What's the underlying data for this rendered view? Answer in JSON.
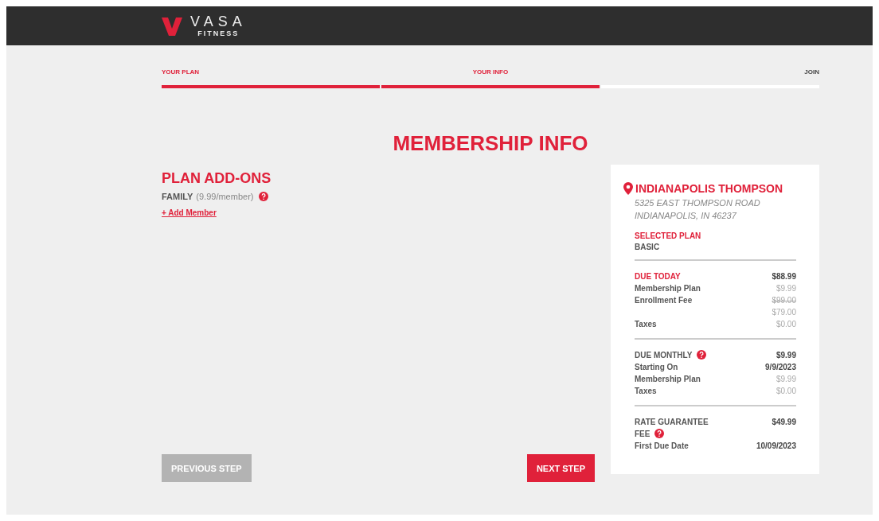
{
  "header": {
    "logo_word": "VASA",
    "logo_sub": "FITNESS"
  },
  "steps": [
    {
      "label": "YOUR PLAN",
      "complete": true
    },
    {
      "label": "YOUR INFO",
      "complete": true
    },
    {
      "label": "JOIN",
      "complete": false
    }
  ],
  "title": "MEMBERSHIP INFO",
  "addons": {
    "heading": "PLAN ADD-ONS",
    "name": "FAMILY",
    "price": "(9.99/member)",
    "help": true,
    "link": "+ Add Member"
  },
  "summary": {
    "location": "INDIANAPOLIS THOMPSON",
    "address_lines": [
      "5325 EAST THOMPSON ROAD",
      "INDIANAPOLIS, IN 46237"
    ],
    "plan_label": "SELECTED PLAN",
    "plan": "BASIC",
    "sections": [
      {
        "rows": [
          {
            "kind": "heading",
            "label": "DUE TODAY",
            "value": "$88.99",
            "help": false
          },
          {
            "kind": "detail",
            "label": "Membership Plan",
            "value": "$9.99",
            "help": false
          },
          {
            "kind": "detail",
            "label": "Enrollment Fee",
            "old_value": "$99.00",
            "value": "$79.00",
            "help": false
          },
          {
            "kind": "detail",
            "label": "Taxes",
            "value": "$0.00",
            "help": false
          }
        ]
      },
      {
        "rows": [
          {
            "kind": "total",
            "label": "DUE MONTHLY",
            "value": "$9.99",
            "help": true
          },
          {
            "kind": "info",
            "label": "Starting On",
            "value": "9/9/2023",
            "help": false
          },
          {
            "kind": "detail",
            "label": "Membership Plan",
            "value": "$9.99",
            "help": false
          },
          {
            "kind": "detail",
            "label": "Taxes",
            "value": "$0.00",
            "help": false
          }
        ]
      },
      {
        "rows": [
          {
            "kind": "total",
            "label": "RATE GUARANTEE",
            "label_wrap": "FEE",
            "value": "$49.99",
            "help": true
          },
          {
            "kind": "info",
            "label": "First Due Date",
            "value": "10/09/2023",
            "help": false
          }
        ]
      }
    ]
  },
  "buttons": {
    "previous": {
      "label": "PREVIOUS STEP",
      "disabled": true
    },
    "next": {
      "label": "NEXT STEP",
      "disabled": false
    }
  }
}
